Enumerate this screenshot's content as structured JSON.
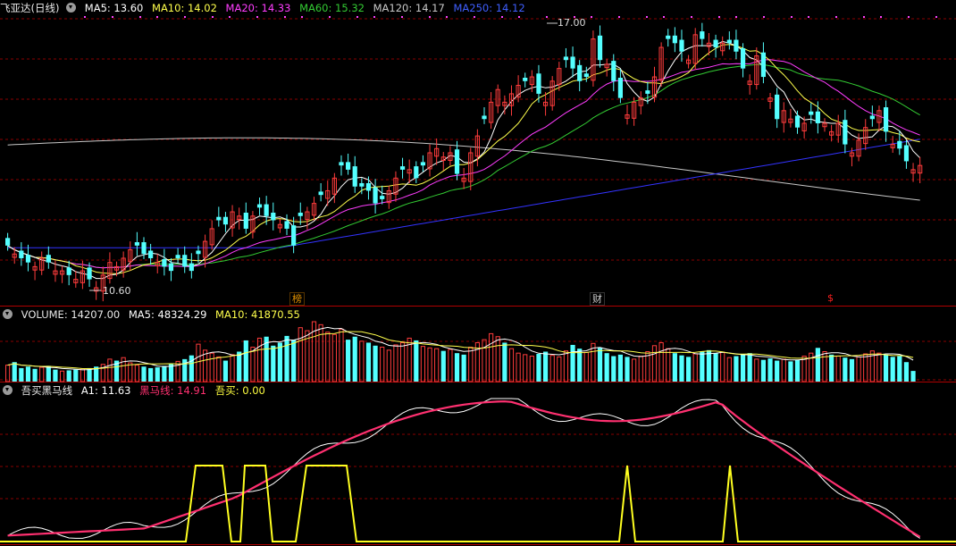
{
  "colors": {
    "up": "#ff3c3c",
    "down": "#54ffff",
    "ma5": "#ffffff",
    "ma10": "#ffff4c",
    "ma20": "#ff3dff",
    "ma60": "#33cc33",
    "ma120": "#c8c8c8",
    "ma250": "#3333ff",
    "grid": "#8a0000",
    "hm": "#ff3070",
    "a1": "#ffffff",
    "buy": "#ffff20"
  },
  "kline": {
    "title": "飞亚达(日线)",
    "ma5": "MA5: 13.60",
    "ma10": "MA10: 14.02",
    "ma20": "MA20: 14.33",
    "ma60": "MA60: 15.32",
    "ma120": "MA120: 14.17",
    "ma250": "MA250: 14.12",
    "high_label": "17.00",
    "low_label": "10.60",
    "event_tags": [
      {
        "text": "榜",
        "color": "#e09000"
      },
      {
        "text": "财",
        "color": "#cccccc"
      },
      {
        "text": "$",
        "color": "#ff2020"
      }
    ]
  },
  "volume": {
    "title": "VOLUME: 14207.00",
    "ma5": "MA5: 48324.29",
    "ma10": "MA10: 41870.55"
  },
  "indicator": {
    "title": "吾买黑马线",
    "a1": "A1: 11.63",
    "hm": "黑马线: 14.91",
    "buy": "吾买: 0.00"
  },
  "chart_data": [
    {
      "type": "candlestick",
      "title": "飞亚达(日线)",
      "ylim": [
        10.6,
        17.0
      ],
      "series": [
        {
          "name": "MA5",
          "value": 13.6
        },
        {
          "name": "MA10",
          "value": 14.02
        },
        {
          "name": "MA20",
          "value": 14.33
        },
        {
          "name": "MA60",
          "value": 15.32
        },
        {
          "name": "MA120",
          "value": 14.17
        },
        {
          "name": "MA250",
          "value": 14.12
        }
      ],
      "annotations": [
        {
          "text": "17.00",
          "kind": "high"
        },
        {
          "text": "10.60",
          "kind": "low"
        }
      ],
      "close": [
        11.6,
        11.4,
        11.3,
        11.2,
        11.1,
        11.3,
        11.2,
        11.0,
        11.0,
        10.9,
        10.8,
        11.0,
        10.8,
        10.6,
        10.9,
        11.2,
        11.1,
        11.3,
        11.5,
        11.6,
        11.4,
        11.3,
        11.2,
        11.1,
        11.0,
        11.3,
        11.1,
        11.0,
        11.4,
        11.7,
        12.0,
        12.2,
        12.1,
        12.4,
        12.3,
        12.0,
        12.3,
        12.5,
        12.3,
        12.2,
        12.1,
        12.0,
        11.6,
        12.3,
        12.4,
        12.6,
        12.8,
        12.9,
        13.2,
        13.5,
        13.4,
        13.0,
        13.0,
        12.9,
        12.6,
        12.7,
        12.9,
        13.2,
        13.4,
        13.4,
        13.2,
        13.5,
        13.8,
        13.9,
        13.7,
        13.8,
        13.3,
        13.2,
        13.8,
        14.2,
        14.6,
        15.0,
        15.3,
        15.0,
        15.2,
        15.4,
        15.5,
        15.6,
        15.2,
        15.0,
        15.5,
        15.8,
        16.0,
        15.8,
        15.5,
        15.6,
        16.5,
        16.0,
        15.9,
        15.5,
        15.1,
        14.7,
        15.0,
        15.1,
        15.2,
        15.6,
        16.3,
        16.5,
        16.4,
        16.2,
        16.0,
        16.6,
        16.5,
        16.4,
        16.3,
        16.4,
        16.4,
        16.2,
        15.8,
        15.5,
        16.1,
        15.6,
        15.1,
        14.6,
        14.8,
        14.6,
        14.4,
        14.5,
        14.7,
        14.5,
        14.5,
        14.3,
        14.5,
        14.0,
        13.8,
        14.1,
        14.4,
        14.6,
        14.8,
        14.3,
        14.0,
        13.9,
        13.6,
        13.4,
        13.5
      ],
      "volume": [
        22000,
        26000,
        18000,
        20000,
        17000,
        19000,
        21000,
        16000,
        14000,
        15000,
        16000,
        17000,
        18000,
        20000,
        23000,
        30000,
        28000,
        32000,
        25000,
        22000,
        20000,
        18000,
        19000,
        21000,
        24000,
        27000,
        30000,
        35000,
        50000,
        42000,
        38000,
        33000,
        28000,
        36000,
        40000,
        55000,
        46000,
        58000,
        60000,
        48000,
        52000,
        61000,
        56000,
        72000,
        68000,
        80000,
        76000,
        66000,
        63000,
        70000,
        56000,
        60000,
        54000,
        52000,
        48000,
        46000,
        42000,
        49000,
        52000,
        58000,
        55000,
        47000,
        45000,
        44000,
        41000,
        43000,
        38000,
        36000,
        46000,
        52000,
        56000,
        64000,
        60000,
        52000,
        44000,
        38000,
        36000,
        34000,
        37000,
        40000,
        35000,
        33000,
        41000,
        49000,
        44000,
        39000,
        51000,
        45000,
        38000,
        34000,
        36000,
        33000,
        30000,
        34000,
        40000,
        48000,
        52000,
        44000,
        38000,
        35000,
        33000,
        37000,
        40000,
        42000,
        38000,
        39000,
        32000,
        34000,
        36000,
        38000,
        30000,
        29000,
        31000,
        28000,
        30000,
        27000,
        29000,
        34000,
        38000,
        45000,
        40000,
        36000,
        34000,
        32000,
        30000,
        33000,
        37000,
        41000,
        38000,
        36000,
        33000,
        34000,
        26000,
        14207
      ]
    },
    {
      "type": "line",
      "title": "吾买黑马线",
      "series": [
        {
          "name": "A1",
          "value": 11.63
        },
        {
          "name": "黑马线",
          "value": 14.91
        },
        {
          "name": "吾买",
          "value": 0.0
        }
      ]
    }
  ]
}
